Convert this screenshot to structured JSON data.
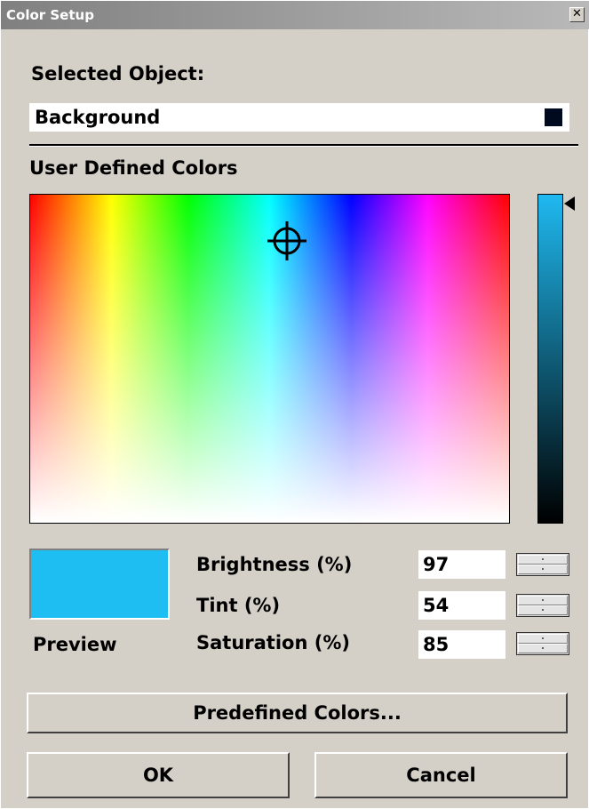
{
  "window": {
    "title": "Color Setup",
    "close_glyph": "✕"
  },
  "selected_object": {
    "label": "Selected Object:",
    "value": "Background",
    "swatch_color": "#000a1e"
  },
  "user_defined": {
    "label": "User Defined Colors"
  },
  "preview": {
    "label": "Preview",
    "color": "#1fbef2"
  },
  "fields": {
    "brightness": {
      "label": "Brightness (%)",
      "value": "97"
    },
    "tint": {
      "label": "Tint (%)",
      "value": "54"
    },
    "saturation": {
      "label": "Saturation (%)",
      "value": "85"
    }
  },
  "buttons": {
    "predefined": "Predefined Colors...",
    "ok": "OK",
    "cancel": "Cancel"
  },
  "icons": {
    "close": "close-icon",
    "crosshair": "crosshair-icon",
    "marker": "brightness-marker-icon"
  }
}
